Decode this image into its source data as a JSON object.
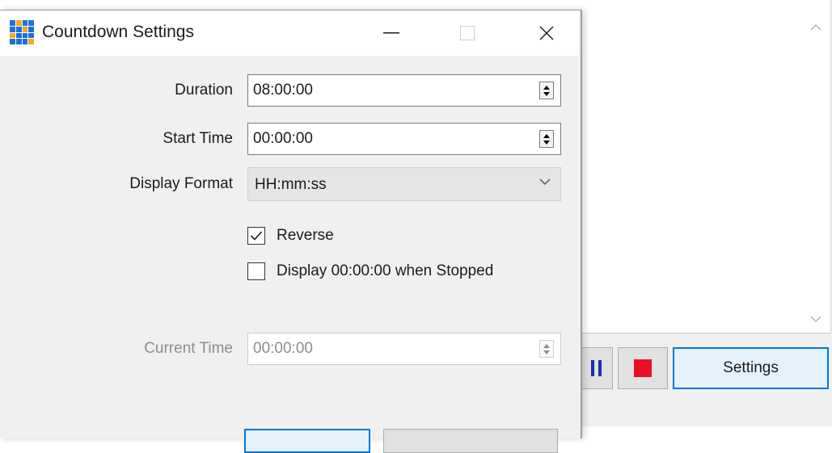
{
  "dialog": {
    "title": "Countdown Settings",
    "fields": {
      "duration": {
        "label": "Duration",
        "value": "08:00:00"
      },
      "start_time": {
        "label": "Start Time",
        "value": "00:00:00"
      },
      "display_format": {
        "label": "Display Format",
        "value": "HH:mm:ss"
      },
      "current_time": {
        "label": "Current Time",
        "value": "00:00:00",
        "disabled": true
      }
    },
    "checkboxes": {
      "reverse": {
        "label": "Reverse",
        "checked": true
      },
      "display_zero_when_stopped": {
        "label": "Display 00:00:00 when Stopped",
        "checked": false
      }
    }
  },
  "main_window": {
    "settings_button": "Settings"
  },
  "colors": {
    "accent": "#0078d7",
    "pause_icon": "#1432b4",
    "stop_icon": "#e81123",
    "dialog_bg": "#f0f0f0"
  }
}
